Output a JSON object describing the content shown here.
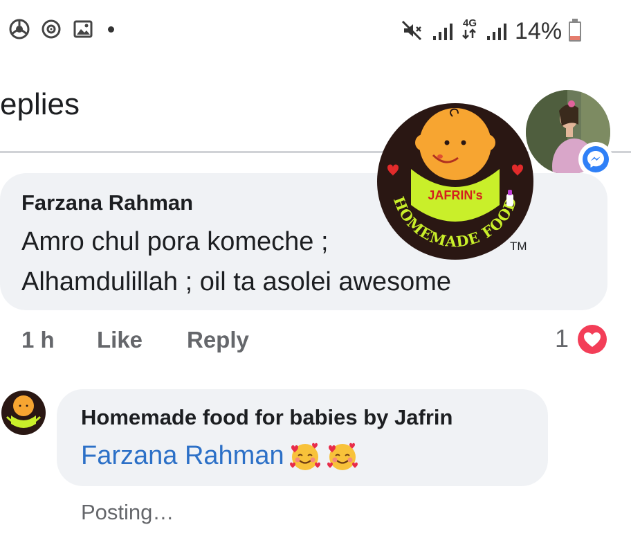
{
  "status_bar": {
    "icons_left": [
      "chrome-icon",
      "sync-icon",
      "image-icon",
      "dot-icon"
    ],
    "icons_right": [
      "mute-icon",
      "signal-icon",
      "4g-icon",
      "signal-icon-2"
    ],
    "network_label": "4G",
    "battery_text": "14%"
  },
  "header": {
    "title": "eplies"
  },
  "comment": {
    "author": "Farzana Rahman",
    "line1": "Amro chul pora komeche ;",
    "line2": "Alhamdulillah ; oil ta asolei awesome",
    "time": "1 h",
    "like_label": "Like",
    "reply_label": "Reply",
    "reaction_count": "1"
  },
  "logo": {
    "text_top": "JAFRIN's",
    "text_arc": "HOMEMADE FOOD",
    "trademark": "TM"
  },
  "reply": {
    "author": "Homemade food for babies by Jafrin",
    "tagged_name": "Farzana Rahman",
    "status": "Posting…"
  },
  "colors": {
    "bubble_bg": "#f0f2f5",
    "link_blue": "#2c70c7",
    "muted_text": "#65676b",
    "heart_red": "#f33e58",
    "messenger_blue": "#2f80f7"
  }
}
